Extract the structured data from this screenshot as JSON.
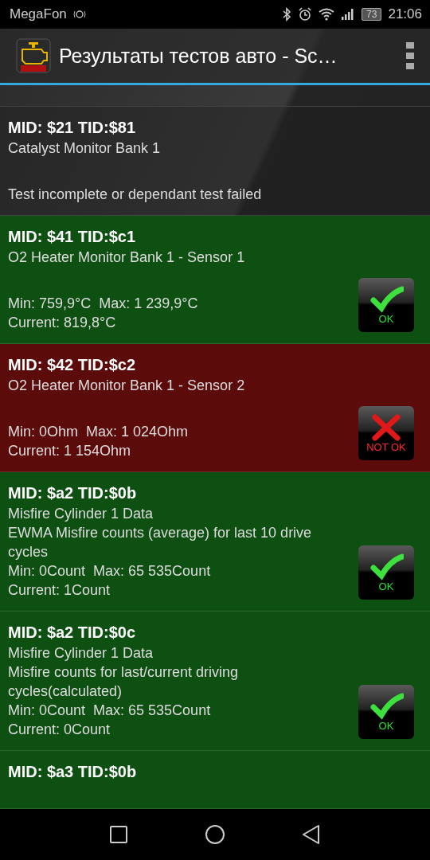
{
  "status_bar": {
    "carrier": "MegaFon",
    "battery": "73",
    "time": "21:06"
  },
  "app_bar": {
    "title": "Результаты тестов авто - Sc…"
  },
  "results": [
    {
      "kind": "incomplete",
      "title": "MID: $21 TID:$81",
      "name": "Catalyst Monitor Bank 1",
      "message": "Test incomplete or dependant test failed"
    },
    {
      "kind": "ok",
      "title": "MID: $41 TID:$c1",
      "name": "O2 Heater Monitor Bank 1 - Sensor 1",
      "range": "Min: 759,9°C  Max: 1 239,9°C",
      "current": "Current: 819,8°C",
      "badge": "OK"
    },
    {
      "kind": "fail",
      "title": "MID: $42 TID:$c2",
      "name": "O2 Heater Monitor Bank 1 - Sensor 2",
      "range": "Min: 0Ohm  Max: 1 024Ohm",
      "current": "Current: 1 154Ohm",
      "badge": "NOT OK"
    },
    {
      "kind": "ok",
      "title": "MID: $a2 TID:$0b",
      "name": "Misfire Cylinder 1 Data",
      "description": "EWMA Misfire counts (average) for last 10 drive cycles",
      "range": "Min: 0Count  Max: 65 535Count",
      "current": "Current: 1Count",
      "badge": "OK"
    },
    {
      "kind": "ok",
      "title": "MID: $a2 TID:$0c",
      "name": "Misfire Cylinder 1 Data",
      "description": "Misfire counts for last/current driving cycles(calculated)",
      "range": "Min: 0Count  Max: 65 535Count",
      "current": "Current: 0Count",
      "badge": "OK"
    },
    {
      "kind": "ok",
      "title": "MID: $a3 TID:$0b"
    }
  ]
}
